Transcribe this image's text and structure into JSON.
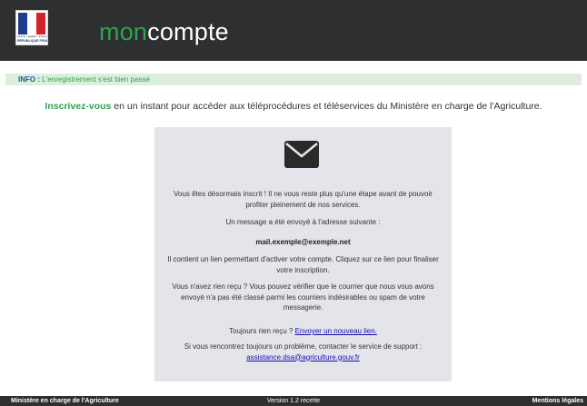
{
  "header": {
    "brand_part1": "mon",
    "brand_part2": "compte",
    "logo": {
      "motto": "Liberté • Égalité • Fraternité",
      "country": "RÉPUBLIQUE FRANÇAISE"
    }
  },
  "info": {
    "label": "INFO :",
    "message": " L'enregistrement s'est bien passé"
  },
  "intro": {
    "strong": "Inscrivez-vous",
    "rest": " en un instant pour accéder aux téléprocédures et téléservices du Ministère en charge de l'Agriculture."
  },
  "panel": {
    "icon": "envelope-icon",
    "paragraph1": "Vous êtes désormais inscrit ! Il ne vous reste plus qu'une étape avant de pouvoir profiter pleinement de nos services.",
    "paragraph2": "Un message a été envoyé à l'adresse suivante :",
    "email": "mail.exemple@exemple.net",
    "paragraph3": "Il contient un lien permettant d'activer votre compte. Cliquez sur ce lien pour finaliser votre inscription.",
    "paragraph4": "Vous n'avez rien reçu ? Vous pouvez vérifier que le courrier que nous vous avons envoyé n'a pas été classé parmi les courriers indésirables ou spam de votre messagerie.",
    "resend_prefix": "Toujours rien reçu ? ",
    "resend_link": "Envoyer un nouveau lien.",
    "support_prefix": "Si vous rencontrez toujours un problème, contacter le service de support : ",
    "support_link": "assistance.dsa@agriculture.gouv.fr"
  },
  "footer": {
    "left": "Ministère en charge de l'Agriculture",
    "center": "Version 1.2 recette",
    "right": "Mentions légales"
  },
  "colors": {
    "header_bg": "#2e2f30",
    "brand_green": "#2ea44f",
    "info_bg": "#ddeedd",
    "panel_bg": "#e3e5eb",
    "link": "#1a0dab"
  }
}
